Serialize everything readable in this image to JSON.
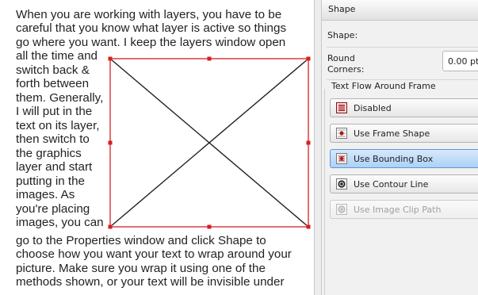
{
  "document": {
    "lines": [
      "When you are working with layers, you have to be",
      "careful that you know what layer is active so things",
      "go where you want. I keep the layers window open",
      "all the time and",
      "switch back &",
      "forth between",
      "them. Generally,",
      "I will put in the",
      "text on its layer,",
      "then switch to",
      "the graphics",
      "layer and start",
      "putting in the",
      "images. As",
      "you're placing",
      "images, you can",
      "go to the Properties window and click Shape to",
      "choose how you want your text to wrap around your",
      "picture. Make sure you wrap it using one of the",
      "methods shown, or your text will be invisible under"
    ]
  },
  "panel": {
    "header": "Shape",
    "shape_label": "Shape:",
    "round_corners_label_1": "Round",
    "round_corners_label_2": "Corners:",
    "round_corners_value": "0.00 pt",
    "text_flow_title": "Text Flow Around Frame",
    "options": [
      {
        "label": "Disabled",
        "icon": "disabled-icon",
        "selected": false,
        "enabled": true
      },
      {
        "label": "Use Frame Shape",
        "icon": "frame-shape-icon",
        "selected": false,
        "enabled": true
      },
      {
        "label": "Use Bounding Box",
        "icon": "bounding-box-icon",
        "selected": true,
        "enabled": true
      },
      {
        "label": "Use Contour Line",
        "icon": "contour-line-icon",
        "selected": false,
        "enabled": true
      },
      {
        "label": "Use Image Clip Path",
        "icon": "image-clip-path-icon",
        "selected": false,
        "enabled": false
      }
    ]
  },
  "colors": {
    "frame_border": "#d62020",
    "handle": "#d62020",
    "selected_option": "#acd1f6",
    "icon_accent": "#b01818"
  }
}
